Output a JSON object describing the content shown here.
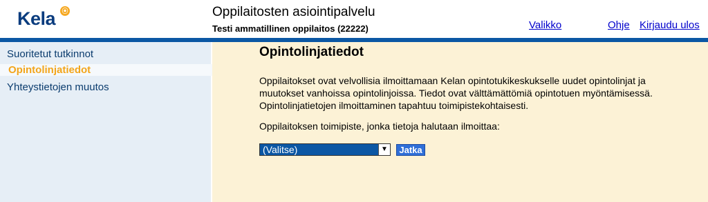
{
  "header": {
    "logo_text": "Kela",
    "title": "Oppilaitosten asiointipalvelu",
    "subtitle": "Testi ammatillinen oppilaitos (22222)",
    "nav": [
      {
        "label": "Valikko"
      },
      {
        "label": "Ohje"
      },
      {
        "label": "Kirjaudu ulos"
      }
    ]
  },
  "sidebar": {
    "items": [
      {
        "label": "Suoritetut tutkinnot",
        "active": false
      },
      {
        "label": "Opintolinjatiedot",
        "active": true
      },
      {
        "label": "Yhteystietojen muutos",
        "active": false
      }
    ]
  },
  "main": {
    "title": "Opintolinjatiedot",
    "description": "Oppilaitokset ovat velvollisia ilmoittamaan Kelan opintotukikeskukselle uudet opintolinjat ja muutokset vanhoissa opintolinjoissa. Tiedot ovat välttämättömiä opintotuen myöntämisessä. Opintolinjatietojen ilmoittaminen tapahtuu toimipistekohtaisesti.",
    "select_label": "Oppilaitoksen toimipiste, jonka tietoja halutaan ilmoittaa:",
    "select_value": "(Valitse)",
    "continue_label": "Jatka"
  },
  "colors": {
    "brand_blue": "#0b57a4",
    "active_nav": "#f3a51a",
    "sidebar_bg": "#e6eef6",
    "content_bg": "#fcf2d6"
  }
}
